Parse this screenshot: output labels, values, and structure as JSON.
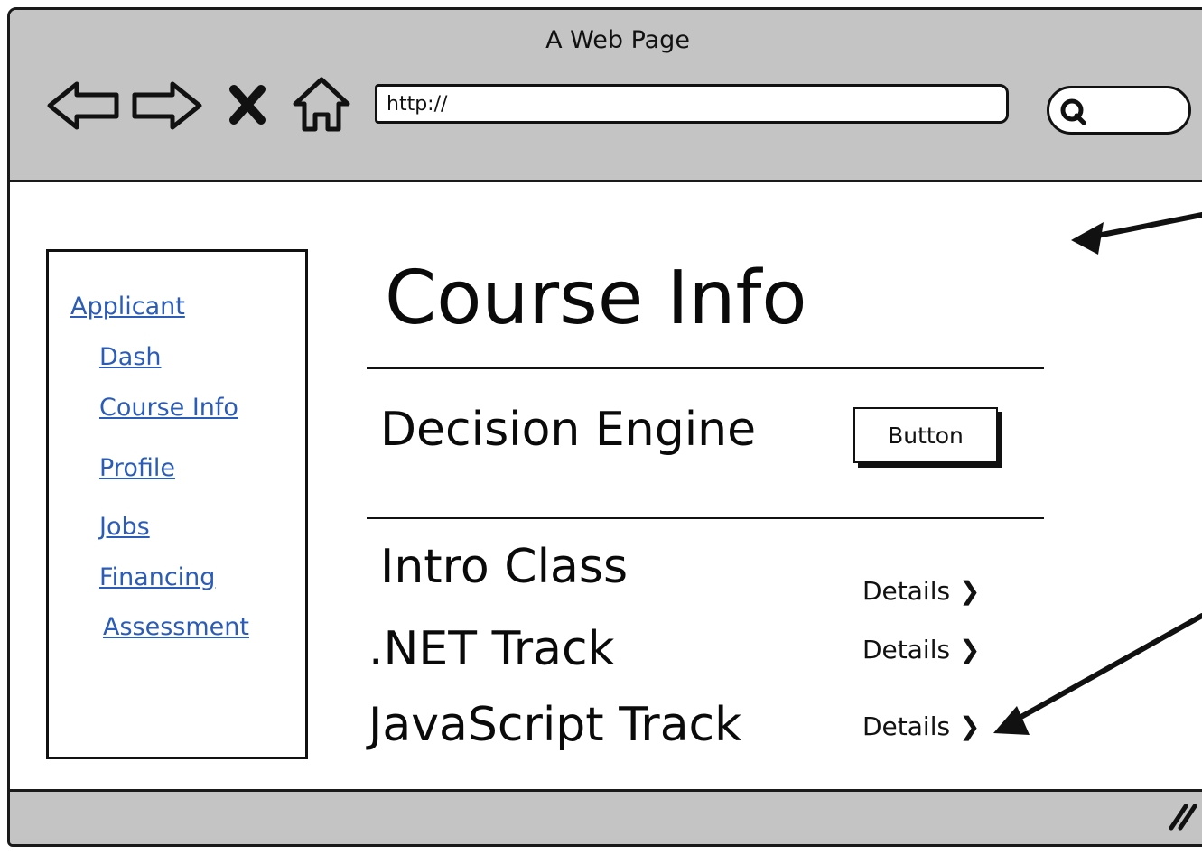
{
  "browser": {
    "window_title": "A Web Page",
    "url_value": "http://",
    "icons": [
      "back-arrow-icon",
      "forward-arrow-icon",
      "close-icon",
      "home-icon",
      "search-icon",
      "resize-grip-icon"
    ]
  },
  "sidebar": {
    "items": [
      {
        "label": "Applicant"
      },
      {
        "label": "Dash"
      },
      {
        "label": "Course Info"
      },
      {
        "label": "Profile"
      },
      {
        "label": "Jobs"
      },
      {
        "label": "Financing"
      },
      {
        "label": "Assessment"
      }
    ]
  },
  "main": {
    "title": "Course Info",
    "decision_engine": {
      "label": "Decision Engine",
      "button_label": "Button"
    },
    "courses": [
      {
        "name": "Intro Class",
        "action": "Details"
      },
      {
        "name": ".NET Track",
        "action": "Details"
      },
      {
        "name": "JavaScript Track",
        "action": "Details"
      }
    ]
  },
  "colors": {
    "chrome": "#c4c4c4",
    "link": "#2a5cb8",
    "ink": "#111111"
  }
}
